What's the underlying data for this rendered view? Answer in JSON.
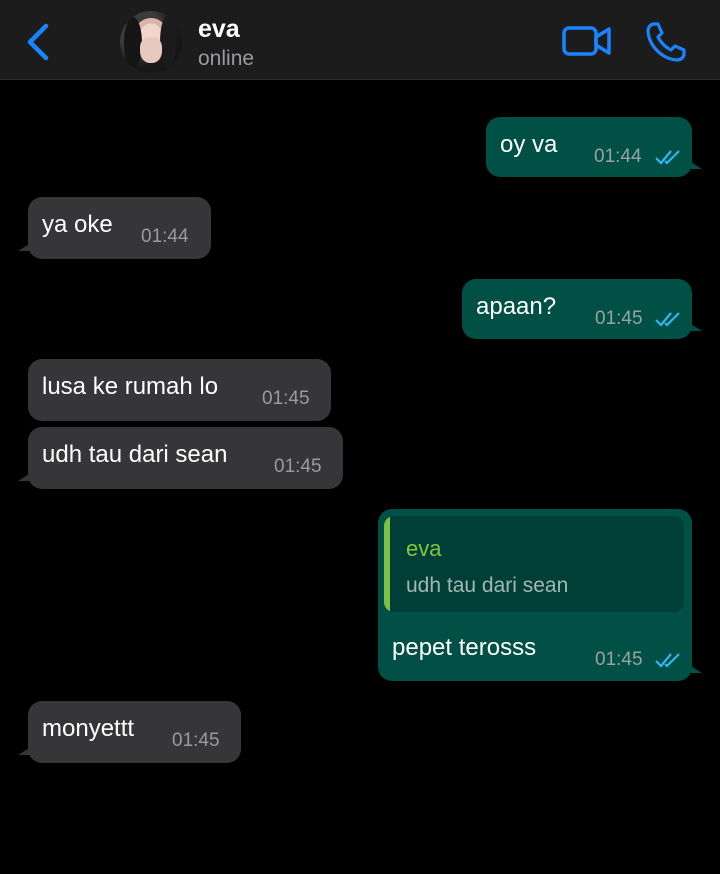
{
  "header": {
    "contact_name": "eva",
    "status": "online",
    "icons": [
      "chevron-left-icon",
      "video-call-icon",
      "phone-call-icon"
    ],
    "accent_color": "#1a84ff"
  },
  "messages": [
    {
      "direction": "out",
      "text": "oy va",
      "time": "01:44",
      "status": "read"
    },
    {
      "direction": "in",
      "text": "ya oke",
      "time": "01:44"
    },
    {
      "direction": "out",
      "text": "apaan?",
      "time": "01:45",
      "status": "read"
    },
    {
      "direction": "in",
      "text": "lusa ke rumah lo",
      "time": "01:45"
    },
    {
      "direction": "in",
      "text": "udh tau dari sean",
      "time": "01:45"
    },
    {
      "direction": "out",
      "text": "pepet terosss",
      "time": "01:45",
      "status": "read",
      "reply_to": {
        "name": "eva",
        "text": "udh tau dari sean"
      }
    },
    {
      "direction": "in",
      "text": "monyettt",
      "time": "01:45"
    }
  ],
  "colors": {
    "outgoing_bubble": "#005046",
    "incoming_bubble": "#363638",
    "read_ticks": "#33b5f0",
    "quote_name": "#83c53d"
  }
}
